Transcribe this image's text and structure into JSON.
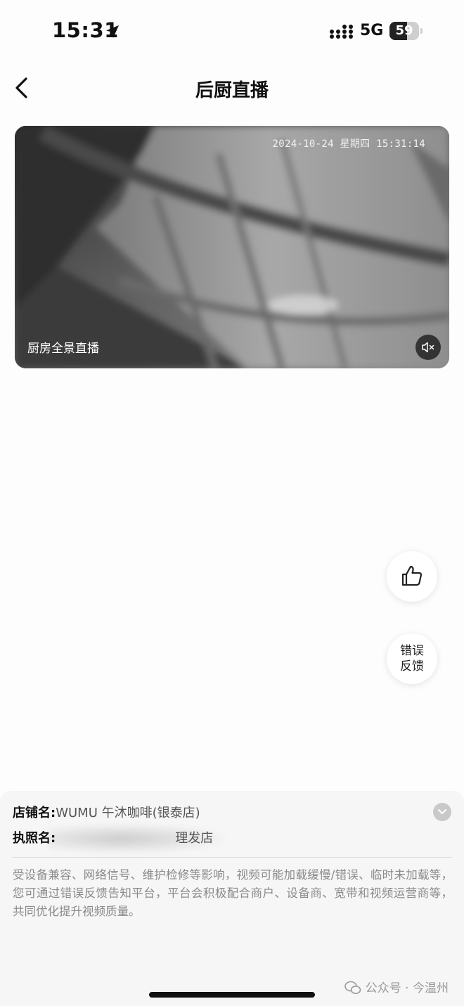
{
  "status_bar": {
    "time": "15:31",
    "network": "5G",
    "battery_level": "59",
    "battery_fraction": 0.59
  },
  "nav": {
    "title": "后厨直播"
  },
  "video": {
    "timestamp": "2024-10-24 星期四 15:31:14",
    "caption": "厨房全景直播",
    "muted": true
  },
  "actions": {
    "like_icon": "thumbs-up-icon",
    "feedback_label_line1": "错误",
    "feedback_label_line2": "反馈"
  },
  "info": {
    "store_key": "店铺名:",
    "store_value": "WUMU 午沐咖啡(银泰店)",
    "license_key": "执照名:",
    "license_value": "理发店",
    "disclaimer": "受设备兼容、网络信号、维护检修等影响，视频可能加载缓慢/错误、临时未加载等，您可通过错误反馈告知平台，平台会积极配合商户、设备商、宽带和视频运营商等，共同优化提升视频质量。"
  },
  "watermark": {
    "text": "公众号 · 今温州"
  }
}
